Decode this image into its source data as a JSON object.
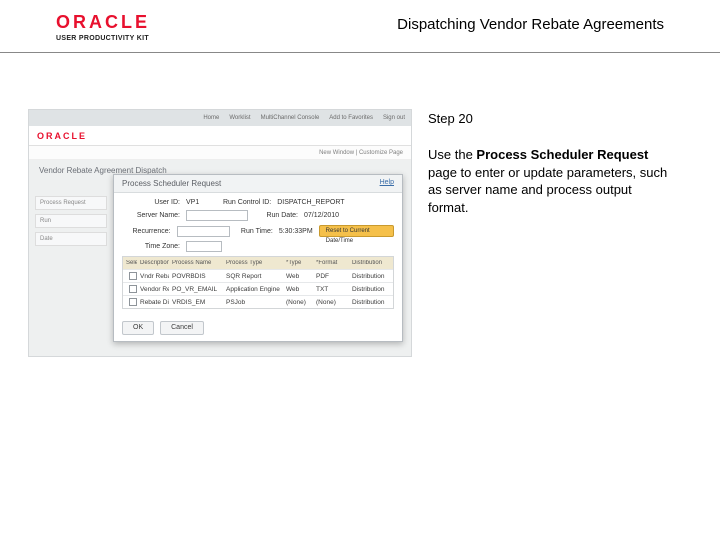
{
  "header": {
    "brand_main": "ORACLE",
    "brand_sub": "USER PRODUCTIVITY KIT",
    "page_title": "Dispatching Vendor Rebate Agreements"
  },
  "right": {
    "step": "Step 20",
    "text_prefix": "Use the ",
    "text_bold": "Process Scheduler Request",
    "text_suffix": " page to enter or update parameters, such as server name and process output format."
  },
  "app": {
    "topnav": [
      "Home",
      "Worklist",
      "MultiChannel Console",
      "Add to Favorites",
      "Sign out"
    ],
    "brand": "ORACLE",
    "subnav": "New Window | Customize Page",
    "section": "Vendor Rebate Agreement Dispatch",
    "side": [
      "Process Request",
      "Run",
      "Date"
    ],
    "modal": {
      "title": "Process Scheduler Request",
      "help": "Help",
      "user_lbl": "User ID:",
      "user_val": "VP1",
      "runctl_lbl": "Run Control ID:",
      "runctl_val": "DISPATCH_REPORT",
      "server_lbl": "Server Name:",
      "server_val": "",
      "rundate_lbl": "Run Date:",
      "rundate_val": "07/12/2010",
      "recur_lbl": "Recurrence:",
      "recur_val": "",
      "runtime_lbl": "Run Time:",
      "runtime_val": "5:30:33PM",
      "tz_lbl": "Time Zone:",
      "tz_btn": "Reset to Current Date/Time",
      "grid_head": [
        "Select",
        "Description",
        "Process Name",
        "Process Type",
        "*Type",
        "*Format",
        "Distribution"
      ],
      "grid_rows": [
        {
          "desc": "Vndr Rebate Dispatch",
          "pname": "POVRBDIS",
          "ptype": "SQR Report",
          "type": "Web",
          "format": "PDF",
          "dist": "Distribution"
        },
        {
          "desc": "Vendor Rebate Email",
          "pname": "PO_VR_EMAIL",
          "ptype": "Application Engine",
          "type": "Web",
          "format": "TXT",
          "dist": "Distribution"
        },
        {
          "desc": "Rebate Dispatch & Email",
          "pname": "VRDIS_EM",
          "ptype": "PSJob",
          "type": "(None)",
          "format": "(None)",
          "dist": "Distribution"
        }
      ],
      "ok": "OK",
      "cancel": "Cancel"
    }
  }
}
